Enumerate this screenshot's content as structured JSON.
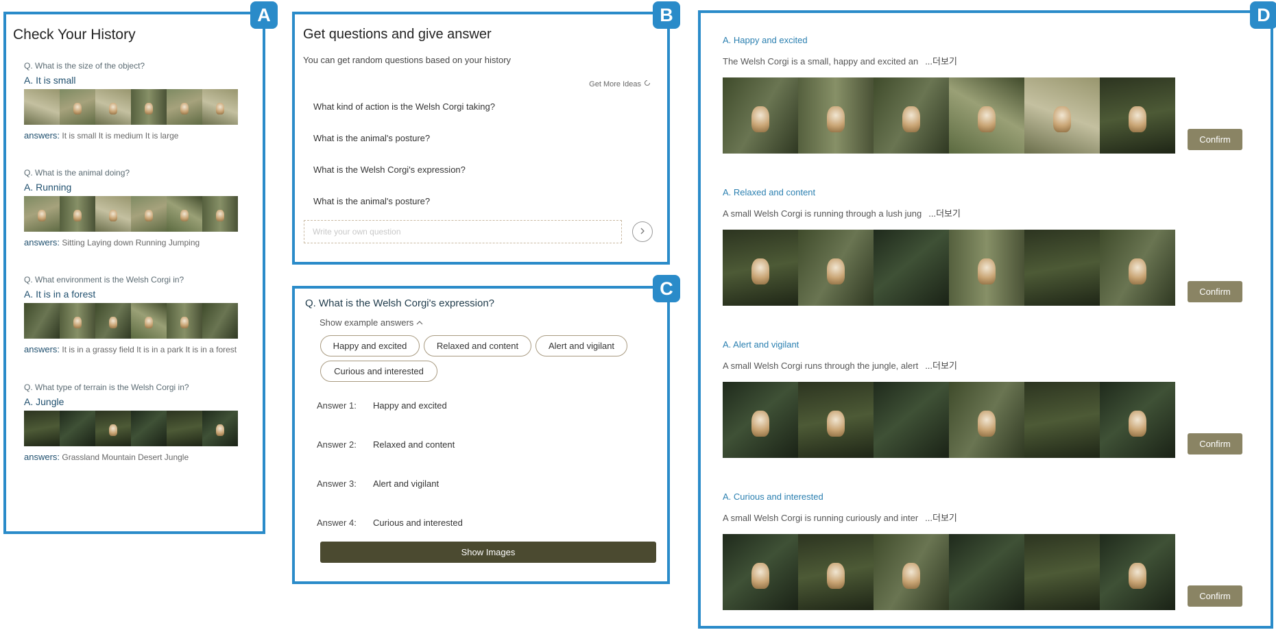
{
  "badges": {
    "a": "A",
    "b": "B",
    "c": "C",
    "d": "D"
  },
  "history": {
    "title": "Check Your History",
    "answers_label": "answers:",
    "items": [
      {
        "question": "Q. What is the size of the object?",
        "answer": "A. It is small",
        "answers": "It is small It is medium It is large"
      },
      {
        "question": "Q. What is the animal doing?",
        "answer": "A. Running",
        "answers": "Sitting Laying down Running Jumping"
      },
      {
        "question": "Q. What environment is the Welsh Corgi in?",
        "answer": "A. It is in a forest",
        "answers": "It is in a grassy field It is in a park It is in a forest"
      },
      {
        "question": "Q. What type of terrain is the Welsh Corgi in?",
        "answer": "A. Jungle",
        "answers": "Grassland Mountain Desert Jungle"
      }
    ]
  },
  "generator": {
    "title": "Get questions and give answer",
    "subtitle": "You can get random questions based on your history",
    "more_ideas": "Get More Ideas",
    "questions": [
      "What kind of action is the Welsh Corgi taking?",
      "What is the animal's posture?",
      "What is the Welsh Corgi's expression?",
      "What is the animal's posture?"
    ],
    "input_placeholder": "Write your own question",
    "send_icon": "chevron-right-icon"
  },
  "answer_panel": {
    "question": "Q. What is the Welsh Corgi's expression?",
    "toggle": "Show example answers",
    "chips": [
      "Happy and excited",
      "Relaxed and content",
      "Alert and vigilant",
      "Curious and interested"
    ],
    "answers": [
      {
        "label": "Answer 1:",
        "value": "Happy and excited"
      },
      {
        "label": "Answer 2:",
        "value": "Relaxed and content"
      },
      {
        "label": "Answer 3:",
        "value": "Alert and vigilant"
      },
      {
        "label": "Answer 4:",
        "value": "Curious and interested"
      }
    ],
    "button": "Show Images"
  },
  "results": {
    "more_label": "...더보기",
    "confirm_label": "Confirm",
    "items": [
      {
        "answer": "A. Happy and excited",
        "description": "The Welsh Corgi is a small, happy and excited an"
      },
      {
        "answer": "A. Relaxed and content",
        "description": "A small Welsh Corgi is running through a lush jung"
      },
      {
        "answer": "A. Alert and vigilant",
        "description": "A small Welsh Corgi runs through the jungle, alert"
      },
      {
        "answer": "A. Curious and interested",
        "description": "A small Welsh Corgi is running curiously and inter"
      }
    ]
  },
  "colors": {
    "accent": "#2a8bc9",
    "button_dark": "#4b4a30",
    "confirm": "#8a8464",
    "answer_link": "#2a7fb0"
  }
}
